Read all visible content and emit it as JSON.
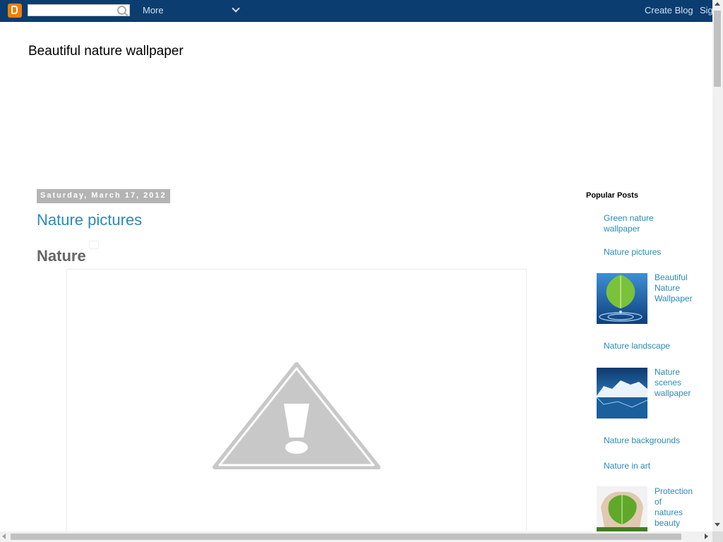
{
  "navbar": {
    "more_label": "More",
    "create_blog_label": "Create Blog",
    "sign_in_label": "Sign In"
  },
  "blog": {
    "title": "Beautiful nature wallpaper"
  },
  "post": {
    "date": "Saturday, March 17, 2012",
    "title": "Nature pictures",
    "heading": "Nature"
  },
  "sidebar": {
    "title": "Popular Posts",
    "items": [
      {
        "label": "Green nature wallpaper"
      },
      {
        "label": "Nature pictures"
      },
      {
        "label": "Beautiful Nature Wallpaper"
      },
      {
        "label": "Nature landscape"
      },
      {
        "label": "Nature scenes wallpaper"
      },
      {
        "label": "Nature backgrounds"
      },
      {
        "label": "Nature in art"
      },
      {
        "label": "Protection of natures beauty"
      }
    ]
  }
}
